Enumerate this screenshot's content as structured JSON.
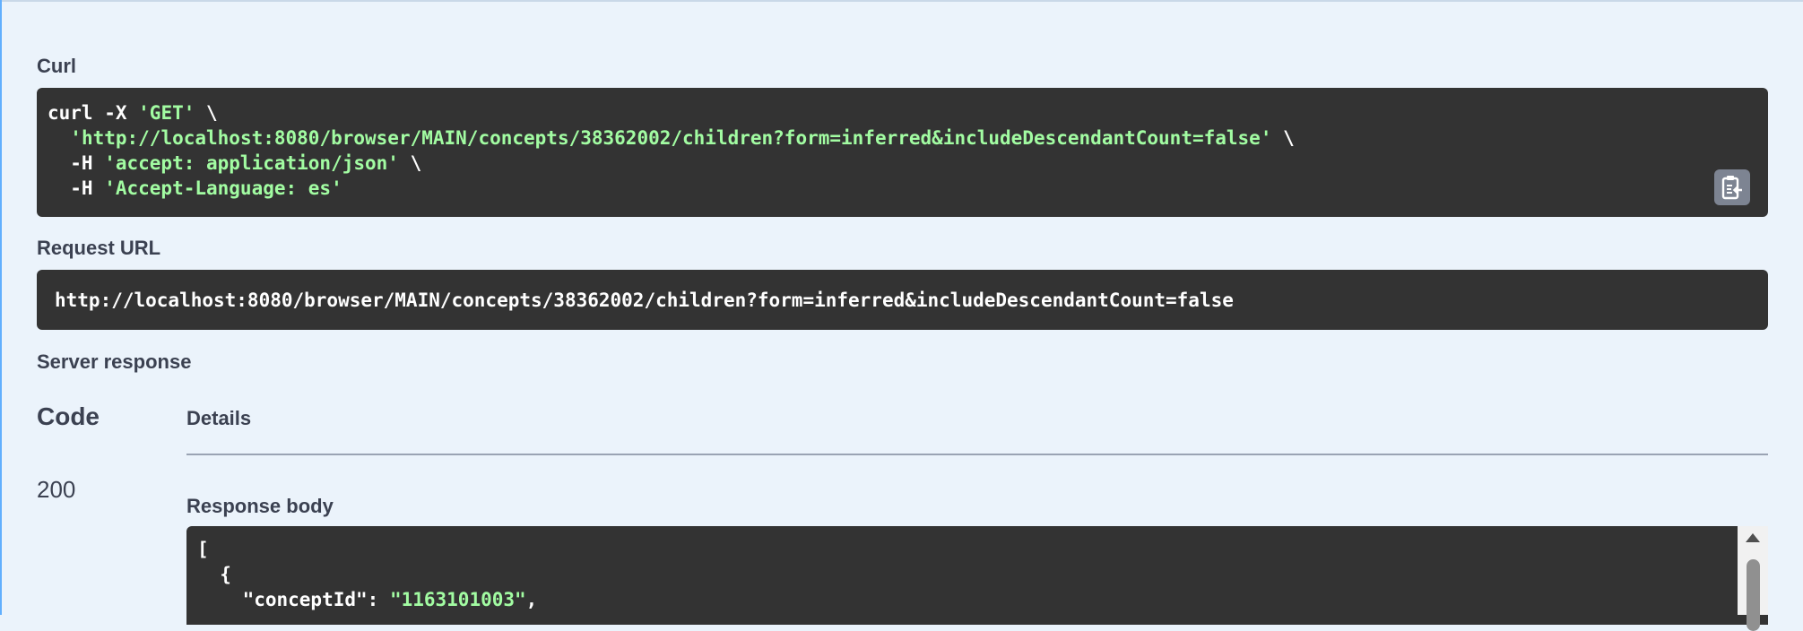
{
  "curl": {
    "label": "Curl",
    "line1": {
      "cmd": "curl -X ",
      "method": "'GET'",
      "tail": " \\"
    },
    "line2": {
      "indent": "  ",
      "url": "'http://localhost:8080/browser/MAIN/concepts/38362002/children?form=inferred&includeDescendantCount=false'",
      "tail": " \\"
    },
    "line3": {
      "flag": "  -H ",
      "value": "'accept: application/json'",
      "tail": " \\"
    },
    "line4": {
      "flag": "  -H ",
      "value": "'Accept-Language: es'"
    }
  },
  "request_url": {
    "label": "Request URL",
    "value": "http://localhost:8080/browser/MAIN/concepts/38362002/children?form=inferred&includeDescendantCount=false"
  },
  "server_response": {
    "label": "Server response",
    "col_code": "Code",
    "col_details": "Details",
    "code": "200",
    "body_label": "Response body",
    "body": {
      "line1": "[",
      "line2": "  {",
      "line3_key": "    \"conceptId\": ",
      "line3_val": "\"1163101003\"",
      "line3_tail": ","
    }
  },
  "icons": {
    "copy": "clipboard-copy-icon",
    "scroll_up": "scroll-up-arrow-icon"
  },
  "colors": {
    "background": "#ebf3fb",
    "code_bg": "#333333",
    "string": "#a2fca2",
    "accent": "#61affe"
  }
}
